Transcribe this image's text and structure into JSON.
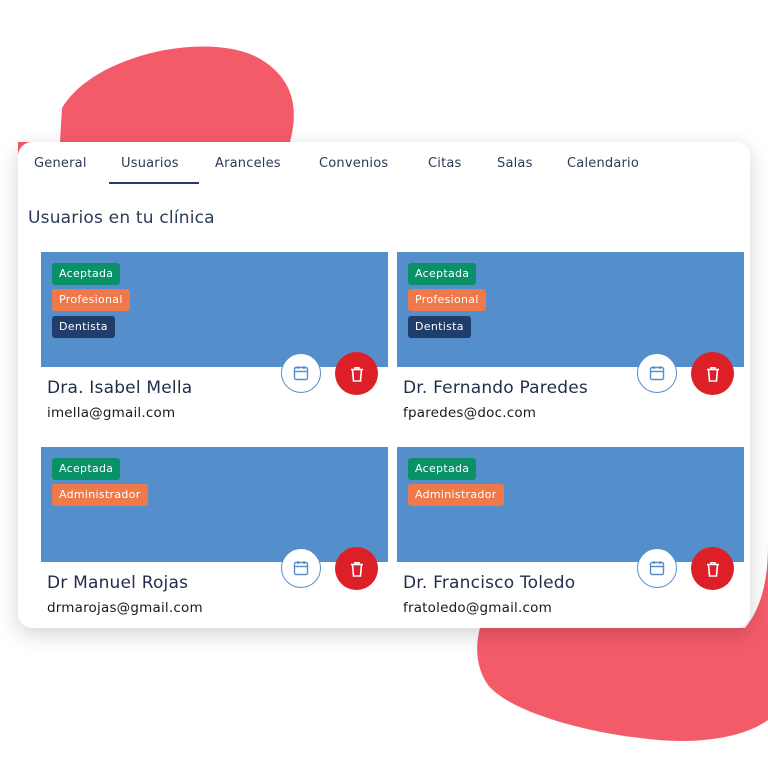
{
  "colors": {
    "blob": "#f45b69",
    "banner": "#548fcc",
    "tab_active_underline": "#243a73",
    "badge_aceptada": "#0b9167",
    "badge_rol_orange": "#f0794b",
    "badge_especialidad": "#203d6b",
    "delete_button": "#dd1f27"
  },
  "tabs": [
    {
      "label": "General",
      "active": false
    },
    {
      "label": "Usuarios",
      "active": true
    },
    {
      "label": "Aranceles",
      "active": false
    },
    {
      "label": "Convenios",
      "active": false
    },
    {
      "label": "Citas",
      "active": false
    },
    {
      "label": "Salas",
      "active": false
    },
    {
      "label": "Calendario",
      "active": false
    }
  ],
  "section_title": "Usuarios en tu clínica",
  "users": [
    {
      "name": "Dra. Isabel Mella",
      "email": "imella@gmail.com",
      "badges": [
        {
          "label": "Aceptada",
          "color": "#0b9167"
        },
        {
          "label": "Profesional",
          "color": "#f0794b"
        },
        {
          "label": "Dentista",
          "color": "#203d6b"
        }
      ]
    },
    {
      "name": "Dr. Fernando Paredes",
      "email": "fparedes@doc.com",
      "badges": [
        {
          "label": "Aceptada",
          "color": "#0b9167"
        },
        {
          "label": "Profesional",
          "color": "#f0794b"
        },
        {
          "label": "Dentista",
          "color": "#203d6b"
        }
      ]
    },
    {
      "name": "Dr Manuel Rojas",
      "email": "drmarojas@gmail.com",
      "badges": [
        {
          "label": "Aceptada",
          "color": "#0b9167"
        },
        {
          "label": "Administrador",
          "color": "#f0794b"
        }
      ]
    },
    {
      "name": "Dr. Francisco Toledo",
      "email": "fratoledo@gmail.com",
      "badges": [
        {
          "label": "Aceptada",
          "color": "#0b9167"
        },
        {
          "label": "Administrador",
          "color": "#f0794b"
        }
      ]
    }
  ],
  "icons": {
    "calendar": "calendar-icon",
    "delete": "trash-icon"
  }
}
